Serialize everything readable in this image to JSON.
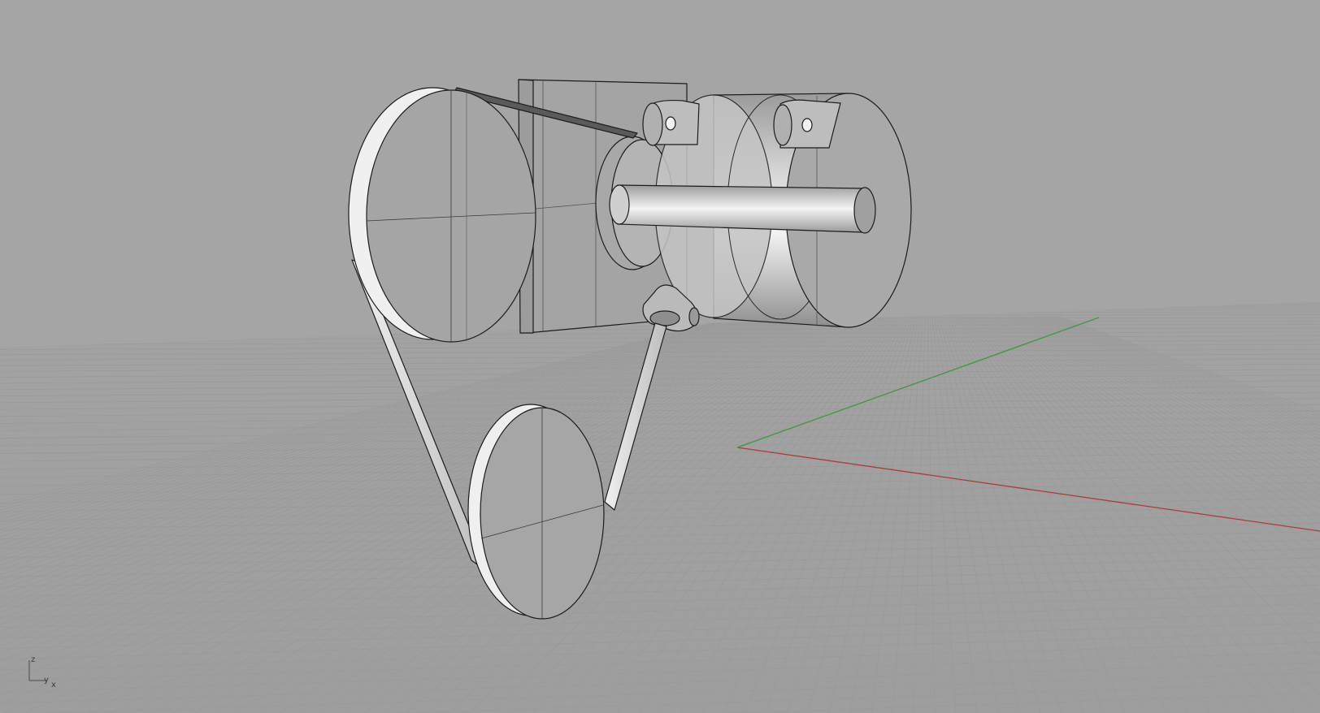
{
  "viewport": {
    "background": "#a3a3a3",
    "display_mode": "ghosted",
    "grid_color": "#9a9a9a",
    "x_axis_color": "#b03a3a",
    "y_axis_color": "#3b9a3b"
  },
  "axis_widget": {
    "z_label": "z",
    "y_label": "y",
    "x_label": "x"
  },
  "model": {
    "parts": [
      "large-pulley",
      "small-pulley",
      "drive-belt",
      "mounting-plate",
      "motor-housing",
      "shaft",
      "mount-brackets",
      "chain-link"
    ]
  }
}
